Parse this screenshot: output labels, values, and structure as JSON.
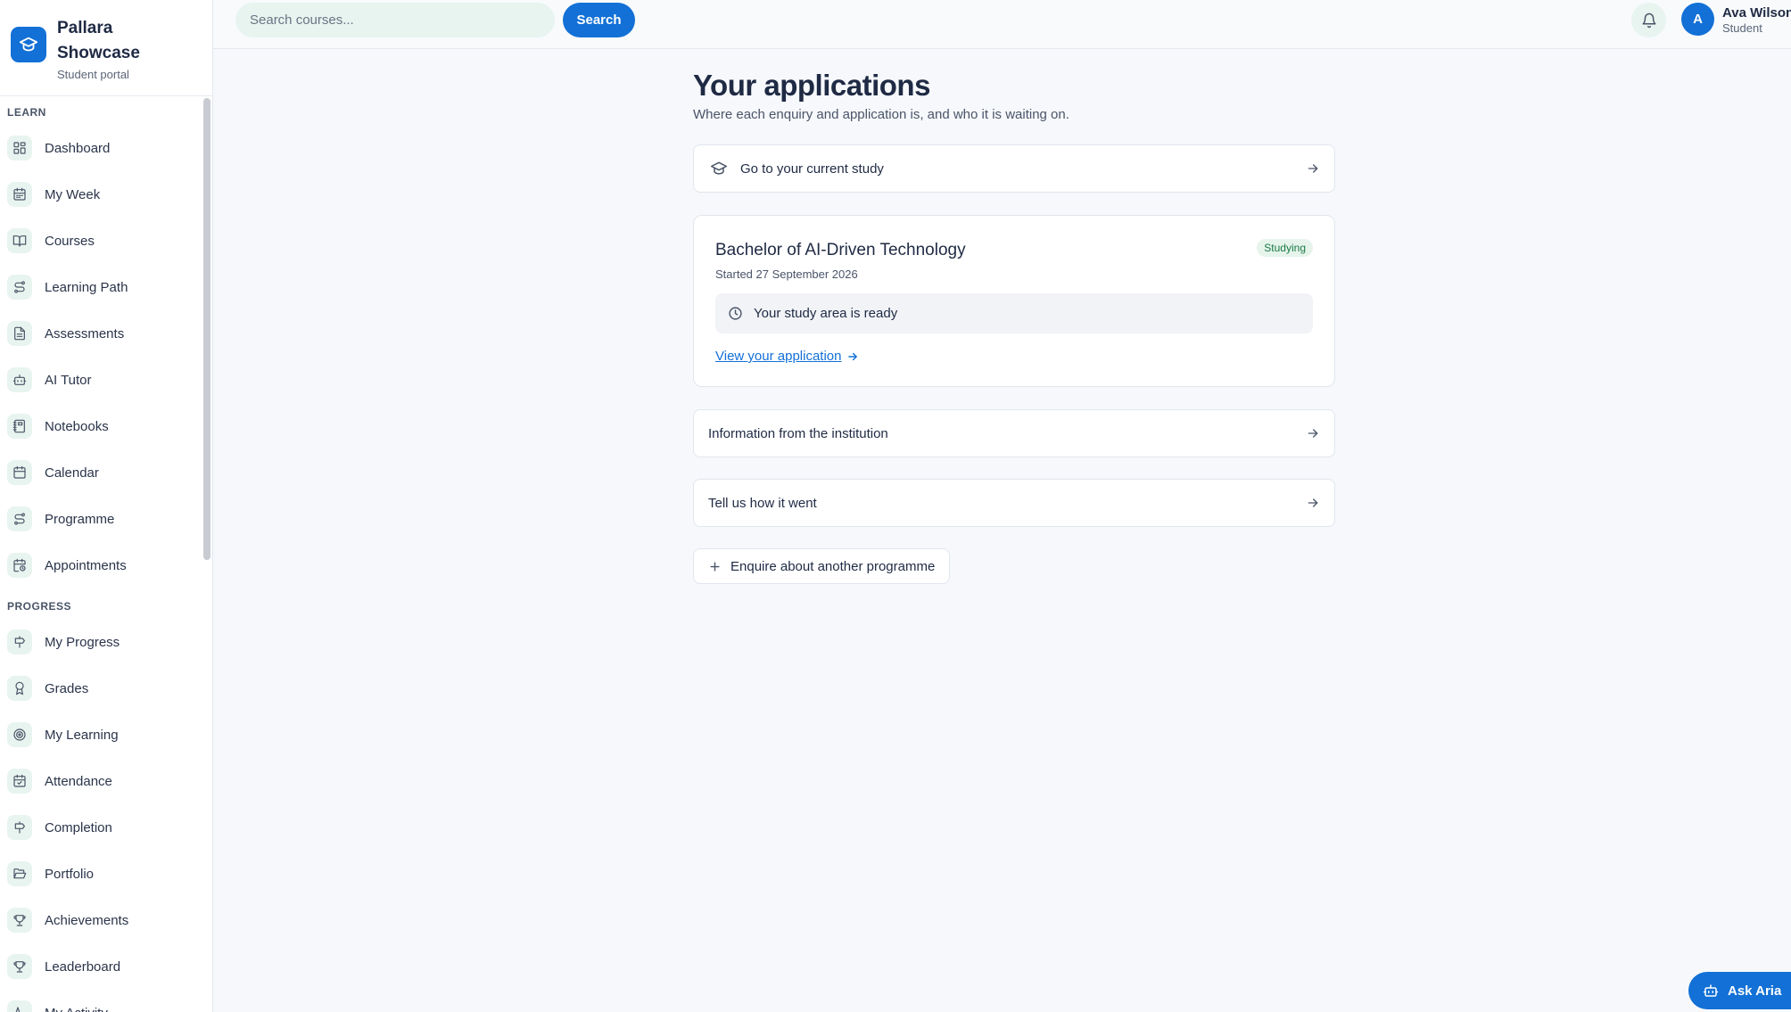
{
  "brand": {
    "name": "Pallara Showcase",
    "subtitle": "Student portal"
  },
  "sidebar": {
    "sections": [
      {
        "label": "LEARN",
        "items": [
          {
            "label": "Dashboard",
            "icon": "dashboard-icon"
          },
          {
            "label": "My Week",
            "icon": "calendar-week-icon"
          },
          {
            "label": "Courses",
            "icon": "book-icon"
          },
          {
            "label": "Learning Path",
            "icon": "route-icon"
          },
          {
            "label": "Assessments",
            "icon": "document-icon"
          },
          {
            "label": "AI Tutor",
            "icon": "robot-icon"
          },
          {
            "label": "Notebooks",
            "icon": "notebook-icon"
          },
          {
            "label": "Calendar",
            "icon": "calendar-icon"
          },
          {
            "label": "Programme",
            "icon": "route-icon"
          },
          {
            "label": "Appointments",
            "icon": "calendar-clock-icon"
          }
        ]
      },
      {
        "label": "PROGRESS",
        "items": [
          {
            "label": "My Progress",
            "icon": "signpost-icon"
          },
          {
            "label": "Grades",
            "icon": "award-icon"
          },
          {
            "label": "My Learning",
            "icon": "target-icon"
          },
          {
            "label": "Attendance",
            "icon": "calendar-check-icon"
          },
          {
            "label": "Completion",
            "icon": "signpost-icon"
          },
          {
            "label": "Portfolio",
            "icon": "folder-open-icon"
          },
          {
            "label": "Achievements",
            "icon": "trophy-icon"
          },
          {
            "label": "Leaderboard",
            "icon": "trophy-icon"
          },
          {
            "label": "My Activity",
            "icon": "activity-icon"
          }
        ]
      }
    ]
  },
  "topbar": {
    "search_placeholder": "Search courses...",
    "search_button": "Search",
    "user": {
      "initial": "A",
      "name": "Ava Wilson",
      "role": "Student"
    }
  },
  "main": {
    "title": "Your applications",
    "subtitle": "Where each enquiry and application is, and who it is waiting on.",
    "current_study_link": "Go to your current study",
    "application": {
      "title": "Bachelor of AI-Driven Technology",
      "status": "Studying",
      "started": "Started 27 September 2026",
      "status_message": "Your study area is ready",
      "view_link": "View your application"
    },
    "info_link": "Information from the institution",
    "feedback_link": "Tell us how it went",
    "enquire_button": "Enquire about another programme"
  },
  "assistant": {
    "label": "Ask Aria"
  },
  "colors": {
    "primary": "#1270d6",
    "icon_bg": "#e8f4ef",
    "badge_bg": "#e6f4ec",
    "badge_text": "#1a7a45"
  }
}
